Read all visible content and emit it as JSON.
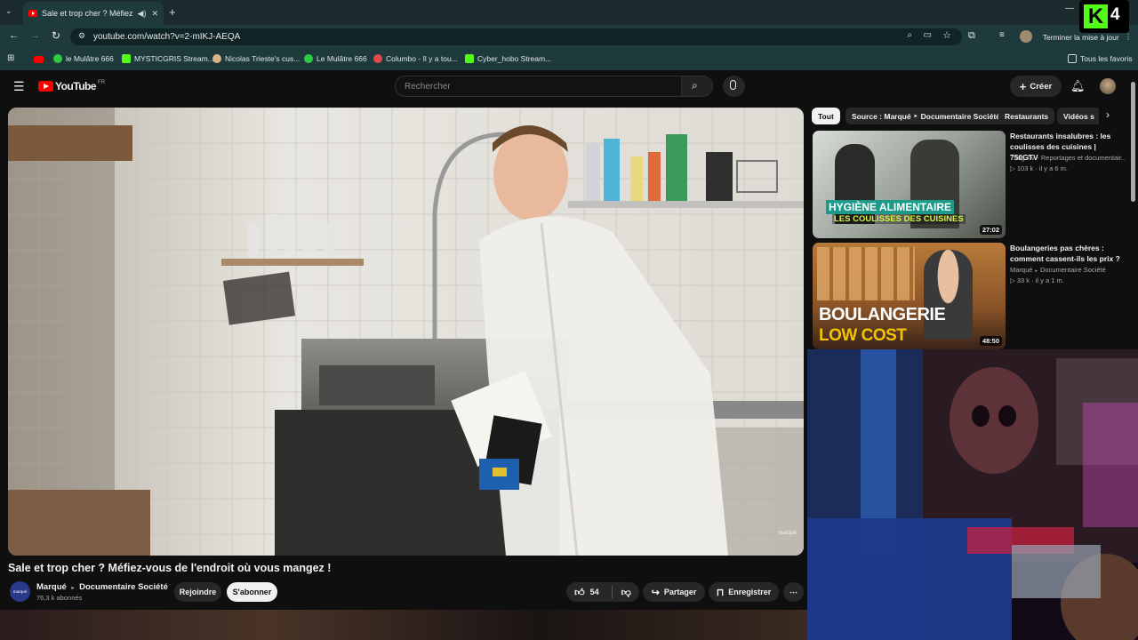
{
  "browser": {
    "tab_title": "Sale et trop cher ? Méfiez-v",
    "url": "youtube.com/watch?v=2-mIKJ-AEQA",
    "update_button": "Terminer la mise à jour",
    "bookmarks": [
      {
        "label": "le Mulâtre 666",
        "color": "#2ecc40"
      },
      {
        "label": "MYSTICGRIS Stream...",
        "color": "#53fc18"
      },
      {
        "label": "Nicolas Trieste's cus...",
        "color": "#d8b48a"
      },
      {
        "label": "Le Mulâtre 666",
        "color": "#2ecc40"
      },
      {
        "label": "Columbo - Il y a tou...",
        "color": "#e04a4a"
      },
      {
        "label": "Cyber_hobo Stream...",
        "color": "#53fc18"
      }
    ],
    "all_bookmarks": "Tous les favoris"
  },
  "youtube": {
    "logo": "YouTube",
    "logo_region": "FR",
    "search_placeholder": "Rechercher",
    "create_label": "Créer"
  },
  "video": {
    "title": "Sale et trop cher ? Méfiez-vous de l'endroit où vous mangez !",
    "channel_name": "Marqué",
    "channel_category": "Documentaire Société",
    "subscribers": "76,3 k abonnés",
    "avatar_text": "marqué",
    "join_label": "Rejoindre",
    "subscribe_label": "S'abonner",
    "likes": "54",
    "share_label": "Partager",
    "save_label": "Enregistrer",
    "watermark": "marqué"
  },
  "sidebar": {
    "chips": [
      "Tout",
      "Source : Marqué",
      "Documentaire Société",
      "Restaurants",
      "Vidéos s"
    ],
    "recommendations": [
      {
        "title": "Restaurants insalubres : les coulisses des cuisines | 750GTV",
        "channel": "750g TV - Reportages et documentair...",
        "views": "103 k",
        "age": "il y a 6 m.",
        "duration": "27:02",
        "thumb_text_1": "HYGIÈNE ALIMENTAIRE",
        "thumb_text_2": "LES COULISSES DES CUISINES"
      },
      {
        "title": "Boulangeries pas chères : comment cassent-ils les prix ?",
        "channel": "Marqué",
        "channel_extra": "Documentaire Société",
        "views": "33 k",
        "age": "il y a 1 m.",
        "duration": "48:50",
        "thumb_text_1": "BOULANGERIE",
        "thumb_text_2": "LOW COST"
      }
    ]
  },
  "overlay": {
    "logo_letter": "K",
    "logo_number": "4"
  },
  "colors": {
    "accent_red": "#ff0000",
    "kick_green": "#53fc18",
    "chrome_bg": "#1f3a3c"
  }
}
